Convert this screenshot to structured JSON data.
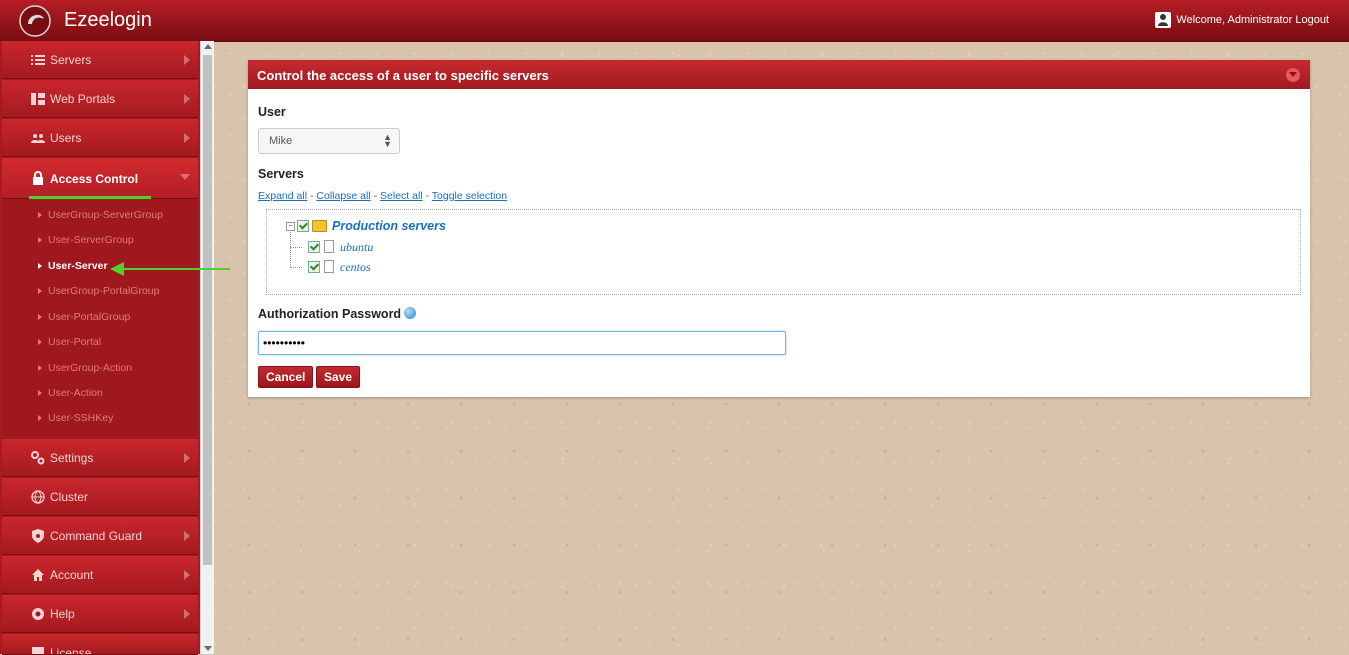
{
  "header": {
    "app_title": "Ezeelogin",
    "welcome_text": "Welcome, Administrator Logout"
  },
  "sidebar": {
    "items": [
      {
        "label": "Servers",
        "icon": "list-icon"
      },
      {
        "label": "Web Portals",
        "icon": "dashboard-icon"
      },
      {
        "label": "Users",
        "icon": "users-icon"
      },
      {
        "label": "Access Control",
        "icon": "lock-icon"
      },
      {
        "label": "Settings",
        "icon": "gears-icon"
      },
      {
        "label": "Cluster",
        "icon": "globe-icon"
      },
      {
        "label": "Command Guard",
        "icon": "shield-icon"
      },
      {
        "label": "Account",
        "icon": "home-icon"
      },
      {
        "label": "Help",
        "icon": "lifebuoy-icon"
      },
      {
        "label": "License",
        "icon": "license-icon"
      }
    ],
    "access_control_submenu": [
      "UserGroup-ServerGroup",
      "User-ServerGroup",
      "User-Server",
      "UserGroup-PortalGroup",
      "User-PortalGroup",
      "User-Portal",
      "UserGroup-Action",
      "User-Action",
      "User-SSHKey"
    ]
  },
  "panel": {
    "title": "Control the access of a user to specific servers",
    "user_label": "User",
    "user_selected": "Mike",
    "servers_label": "Servers",
    "links": {
      "expand_all": "Expand all",
      "collapse_all": "Collapse all",
      "select_all": "Select all",
      "toggle_selection": "Toggle selection",
      "separator": " - "
    },
    "tree": {
      "group": "Production servers",
      "servers": [
        "ubuntu",
        "centos"
      ]
    },
    "auth_label": "Authorization Password",
    "password_value": "••••••••••",
    "cancel_label": "Cancel",
    "save_label": "Save"
  },
  "colors": {
    "brand_red": "#b51e24",
    "highlight_green": "#4ed12c",
    "link_blue": "#1a6fc0"
  }
}
